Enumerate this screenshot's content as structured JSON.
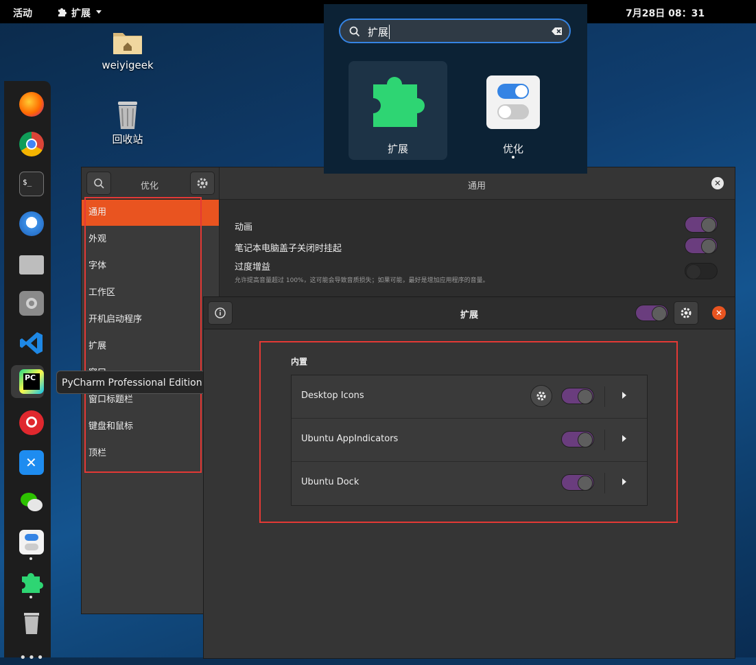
{
  "topbar": {
    "activities": "活动",
    "app_menu": "扩展",
    "clock": "7月28日  08：31"
  },
  "desktop": {
    "items": [
      {
        "label": "weiyigeek",
        "icon": "home-folder-icon"
      },
      {
        "label": "回收站",
        "icon": "trash-icon"
      }
    ]
  },
  "dock": {
    "apps": [
      "firefox-icon",
      "chrome-icon",
      "terminal-icon",
      "thunderbird-icon",
      "files-icon",
      "settings-icon",
      "vscode-icon",
      "pycharm-icon",
      "netease-music-icon",
      "kite-icon",
      "wechat-icon",
      "tweaks-icon",
      "extensions-icon",
      "trash-icon",
      "show-apps-icon"
    ]
  },
  "tooltip": "PyCharm Professional Edition",
  "search": {
    "query": "扩展",
    "results": [
      {
        "label": "扩展",
        "icon": "puzzle-icon"
      },
      {
        "label": "优化",
        "icon": "tweaks-toggle-icon"
      }
    ]
  },
  "tweaks": {
    "sidebar_title": "优化",
    "header_title": "通用",
    "nav": [
      "通用",
      "外观",
      "字体",
      "工作区",
      "开机启动程序",
      "扩展",
      "窗口",
      "窗口标题栏",
      "键盘和鼠标",
      "顶栏"
    ],
    "settings": [
      {
        "label": "动画",
        "on": true
      },
      {
        "label": "笔记本电脑盖子关闭时挂起",
        "on": true
      },
      {
        "label": "过度增益",
        "on": false,
        "description": "允许提高音量超过 100%，这可能会导致音质损失；如果可能，最好是增加应用程序的音量。"
      }
    ]
  },
  "extensions": {
    "title": "扩展",
    "master_on": true,
    "section": "内置",
    "items": [
      {
        "name": "Desktop Icons",
        "has_settings": true,
        "on": true
      },
      {
        "name": "Ubuntu AppIndicators",
        "has_settings": false,
        "on": true
      },
      {
        "name": "Ubuntu Dock",
        "has_settings": false,
        "on": true
      }
    ]
  },
  "colors": {
    "accent": "#e95420",
    "switch_on": "#6a3d7e",
    "highlight_box": "#e53935",
    "search_focus": "#3584e4"
  }
}
